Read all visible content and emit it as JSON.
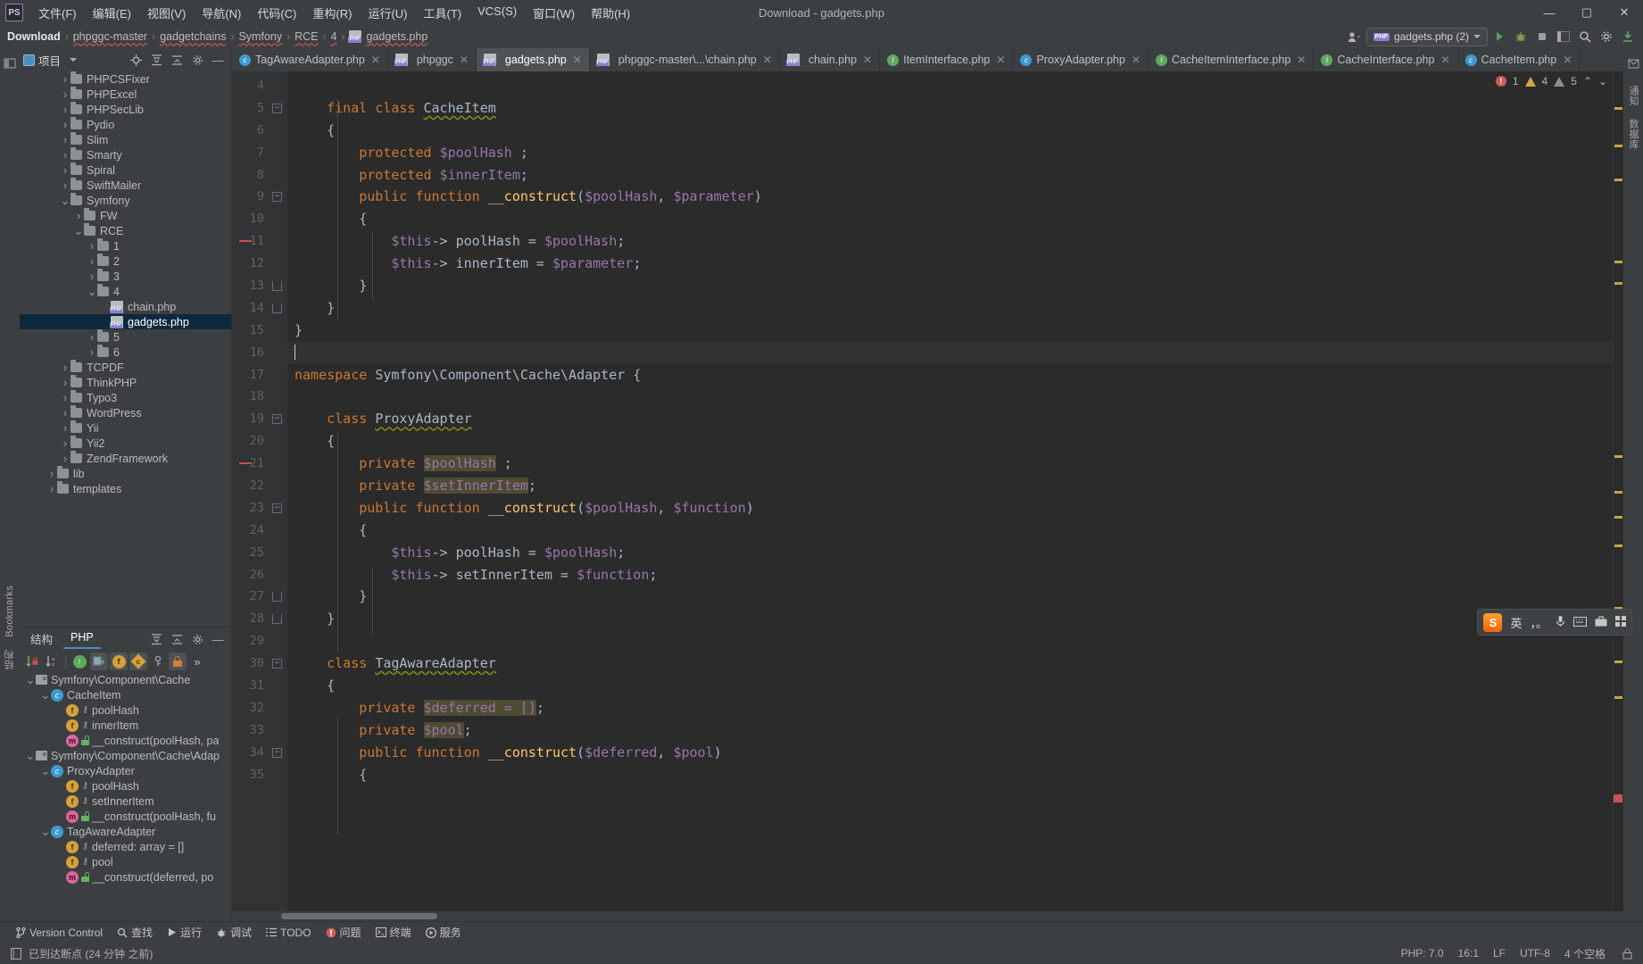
{
  "window": {
    "title": "Download - gadgets.php",
    "app_logo": "PS",
    "minimize": "—",
    "maximize": "▢",
    "close": "✕"
  },
  "menu": [
    {
      "label": "文件(F)",
      "name": "menu-file"
    },
    {
      "label": "编辑(E)",
      "name": "menu-edit"
    },
    {
      "label": "视图(V)",
      "name": "menu-view"
    },
    {
      "label": "导航(N)",
      "name": "menu-navigate"
    },
    {
      "label": "代码(C)",
      "name": "menu-code"
    },
    {
      "label": "重构(R)",
      "name": "menu-refactor"
    },
    {
      "label": "运行(U)",
      "name": "menu-run"
    },
    {
      "label": "工具(T)",
      "name": "menu-tools"
    },
    {
      "label": "VCS(S)",
      "name": "menu-vcs"
    },
    {
      "label": "窗口(W)",
      "name": "menu-window"
    },
    {
      "label": "帮助(H)",
      "name": "menu-help"
    }
  ],
  "breadcrumbs": [
    {
      "label": "Download",
      "icon": ""
    },
    {
      "label": "phpggc-master",
      "icon": ""
    },
    {
      "label": "gadgetchains",
      "icon": ""
    },
    {
      "label": "Symfony",
      "icon": ""
    },
    {
      "label": "RCE",
      "icon": ""
    },
    {
      "label": "4",
      "icon": ""
    },
    {
      "label": "gadgets.php",
      "icon": "php-file-icon"
    }
  ],
  "navbar_right": {
    "run_config": "gadgets.php (2)",
    "user_icon": "user-icon",
    "run": "run-icon",
    "debug": "debug-icon",
    "stop": "stop-icon",
    "layout": "layout-icon",
    "search_everywhere": "magnifier-icon",
    "settings": "gear-icon",
    "updates": "update-icon"
  },
  "project_panel": {
    "title": "项目",
    "tools": [
      "locate-icon",
      "expand-all-icon",
      "collapse-all-icon",
      "gear-icon",
      "hide-icon"
    ],
    "items": [
      {
        "label": "PHPCSFixer",
        "type": "folder",
        "depth": 3,
        "expanded": false
      },
      {
        "label": "PHPExcel",
        "type": "folder",
        "depth": 3,
        "expanded": false
      },
      {
        "label": "PHPSecLib",
        "type": "folder",
        "depth": 3,
        "expanded": false
      },
      {
        "label": "Pydio",
        "type": "folder",
        "depth": 3,
        "expanded": false
      },
      {
        "label": "Slim",
        "type": "folder",
        "depth": 3,
        "expanded": false
      },
      {
        "label": "Smarty",
        "type": "folder",
        "depth": 3,
        "expanded": false
      },
      {
        "label": "Spiral",
        "type": "folder",
        "depth": 3,
        "expanded": false
      },
      {
        "label": "SwiftMailer",
        "type": "folder",
        "depth": 3,
        "expanded": false
      },
      {
        "label": "Symfony",
        "type": "folder",
        "depth": 3,
        "expanded": true,
        "wavy": true
      },
      {
        "label": "FW",
        "type": "folder",
        "depth": 4,
        "expanded": false
      },
      {
        "label": "RCE",
        "type": "folder",
        "depth": 4,
        "expanded": true,
        "wavy": true
      },
      {
        "label": "1",
        "type": "folder",
        "depth": 5,
        "expanded": false
      },
      {
        "label": "2",
        "type": "folder",
        "depth": 5,
        "expanded": false
      },
      {
        "label": "3",
        "type": "folder",
        "depth": 5,
        "expanded": false
      },
      {
        "label": "4",
        "type": "folder",
        "depth": 5,
        "expanded": true,
        "wavy": true
      },
      {
        "label": "chain.php",
        "type": "php",
        "depth": 6,
        "expanded": null
      },
      {
        "label": "gadgets.php",
        "type": "php",
        "depth": 6,
        "expanded": null,
        "selected": true,
        "wavy": true
      },
      {
        "label": "5",
        "type": "folder",
        "depth": 5,
        "expanded": false
      },
      {
        "label": "6",
        "type": "folder",
        "depth": 5,
        "expanded": false
      },
      {
        "label": "TCPDF",
        "type": "folder",
        "depth": 3,
        "expanded": false
      },
      {
        "label": "ThinkPHP",
        "type": "folder",
        "depth": 3,
        "expanded": false
      },
      {
        "label": "Typo3",
        "type": "folder",
        "depth": 3,
        "expanded": false
      },
      {
        "label": "WordPress",
        "type": "folder",
        "depth": 3,
        "expanded": false
      },
      {
        "label": "Yii",
        "type": "folder",
        "depth": 3,
        "expanded": false
      },
      {
        "label": "Yii2",
        "type": "folder",
        "depth": 3,
        "expanded": false
      },
      {
        "label": "ZendFramework",
        "type": "folder",
        "depth": 3,
        "expanded": false
      },
      {
        "label": "lib",
        "type": "folder",
        "depth": 2,
        "expanded": false
      },
      {
        "label": "templates",
        "type": "folder",
        "depth": 2,
        "expanded": false
      }
    ]
  },
  "structure_panel": {
    "tab_structure": "结构",
    "tab_php": "PHP",
    "items": [
      {
        "label": "Symfony\\Component\\Cache",
        "kind": "package",
        "depth": 0,
        "expanded": true
      },
      {
        "label": "CacheItem",
        "kind": "class",
        "depth": 1,
        "expanded": true
      },
      {
        "label": "poolHash",
        "kind": "field",
        "depth": 2,
        "visibility": "protected"
      },
      {
        "label": "innerItem",
        "kind": "field",
        "depth": 2,
        "visibility": "protected"
      },
      {
        "label": "__construct(poolHash, pa",
        "kind": "method",
        "depth": 2,
        "visibility": "public"
      },
      {
        "label": "Symfony\\Component\\Cache\\Adap",
        "kind": "package",
        "depth": 0,
        "expanded": true
      },
      {
        "label": "ProxyAdapter",
        "kind": "class",
        "depth": 1,
        "expanded": true
      },
      {
        "label": "poolHash",
        "kind": "field",
        "depth": 2,
        "visibility": "private"
      },
      {
        "label": "setInnerItem",
        "kind": "field",
        "depth": 2,
        "visibility": "private"
      },
      {
        "label": "__construct(poolHash, fu",
        "kind": "method",
        "depth": 2,
        "visibility": "public"
      },
      {
        "label": "TagAwareAdapter",
        "kind": "class",
        "depth": 1,
        "expanded": true
      },
      {
        "label": "deferred: array = []",
        "kind": "field",
        "depth": 2,
        "visibility": "private"
      },
      {
        "label": "pool",
        "kind": "field",
        "depth": 2,
        "visibility": "private"
      },
      {
        "label": "__construct(deferred, po",
        "kind": "method",
        "depth": 2,
        "visibility": "public"
      }
    ]
  },
  "editor_tabs": [
    {
      "label": "TagAwareAdapter.php",
      "icon": "class-icon",
      "active": false
    },
    {
      "label": "phpggc",
      "icon": "php-file-icon",
      "active": false
    },
    {
      "label": "gadgets.php",
      "icon": "php-file-icon",
      "active": true
    },
    {
      "label": "phpggc-master\\...\\chain.php",
      "icon": "php-file-icon",
      "active": false
    },
    {
      "label": "chain.php",
      "icon": "php-file-icon",
      "active": false
    },
    {
      "label": "ItemInterface.php",
      "icon": "interface-icon",
      "active": false
    },
    {
      "label": "ProxyAdapter.php",
      "icon": "class-icon",
      "active": false
    },
    {
      "label": "CacheItemInterface.php",
      "icon": "interface-icon",
      "active": false
    },
    {
      "label": "CacheInterface.php",
      "icon": "interface-icon",
      "active": false
    },
    {
      "label": "CacheItem.php",
      "icon": "class-icon",
      "active": false
    }
  ],
  "inspections": {
    "errors": "1",
    "warnings": "4",
    "weak_warnings": "5",
    "up": "⌃",
    "down": "⌄"
  },
  "code": {
    "first_line": 4,
    "current_line": 16,
    "lines": [
      {
        "n": 4,
        "tokens": [],
        "fold": null
      },
      {
        "n": 5,
        "tokens": [
          {
            "t": "    ",
            "c": "p"
          },
          {
            "t": "final class ",
            "c": "k"
          },
          {
            "t": "CacheItem",
            "c": "cl"
          }
        ],
        "fold": "start"
      },
      {
        "n": 6,
        "tokens": [
          {
            "t": "    {",
            "c": "p"
          }
        ],
        "fold": null
      },
      {
        "n": 7,
        "tokens": [
          {
            "t": "        ",
            "c": "p"
          },
          {
            "t": "protected ",
            "c": "k"
          },
          {
            "t": "$poolHash",
            "c": "v"
          },
          {
            "t": " ;",
            "c": "p"
          }
        ],
        "fold": null
      },
      {
        "n": 8,
        "tokens": [
          {
            "t": "        ",
            "c": "p"
          },
          {
            "t": "protected ",
            "c": "k"
          },
          {
            "t": "$innerItem",
            "c": "v"
          },
          {
            "t": ";",
            "c": "p"
          }
        ],
        "fold": null
      },
      {
        "n": 9,
        "tokens": [
          {
            "t": "        ",
            "c": "p"
          },
          {
            "t": "public function ",
            "c": "k"
          },
          {
            "t": "__construct",
            "c": "fn"
          },
          {
            "t": "(",
            "c": "p"
          },
          {
            "t": "$poolHash",
            "c": "v"
          },
          {
            "t": ", ",
            "c": "p"
          },
          {
            "t": "$parameter",
            "c": "v"
          },
          {
            "t": ")",
            "c": "p"
          }
        ],
        "fold": "start"
      },
      {
        "n": 10,
        "tokens": [
          {
            "t": "        {",
            "c": "p"
          }
        ],
        "fold": null
      },
      {
        "n": 11,
        "tokens": [
          {
            "t": "            ",
            "c": "p"
          },
          {
            "t": "$this",
            "c": "v"
          },
          {
            "t": "-> poolHash = ",
            "c": "p"
          },
          {
            "t": "$poolHash",
            "c": "v"
          },
          {
            "t": ";",
            "c": "p"
          }
        ],
        "fold": null,
        "breakpoint": true
      },
      {
        "n": 12,
        "tokens": [
          {
            "t": "            ",
            "c": "p"
          },
          {
            "t": "$this",
            "c": "v"
          },
          {
            "t": "-> innerItem = ",
            "c": "p"
          },
          {
            "t": "$parameter",
            "c": "v"
          },
          {
            "t": ";",
            "c": "p"
          }
        ],
        "fold": null
      },
      {
        "n": 13,
        "tokens": [
          {
            "t": "        }",
            "c": "p"
          }
        ],
        "fold": "end"
      },
      {
        "n": 14,
        "tokens": [
          {
            "t": "    }",
            "c": "p"
          }
        ],
        "fold": "end"
      },
      {
        "n": 15,
        "tokens": [
          {
            "t": "}",
            "c": "p"
          }
        ],
        "fold": null
      },
      {
        "n": 16,
        "tokens": [],
        "fold": null,
        "current": true
      },
      {
        "n": 17,
        "tokens": [
          {
            "t": "namespace ",
            "c": "k"
          },
          {
            "t": "Symfony\\Component\\Cache\\Adapter",
            "c": "p"
          },
          {
            "t": " {",
            "c": "p"
          }
        ],
        "fold": null
      },
      {
        "n": 18,
        "tokens": [],
        "fold": null
      },
      {
        "n": 19,
        "tokens": [
          {
            "t": "    ",
            "c": "p"
          },
          {
            "t": "class ",
            "c": "k"
          },
          {
            "t": "ProxyAdapter",
            "c": "cl"
          }
        ],
        "fold": "start"
      },
      {
        "n": 20,
        "tokens": [
          {
            "t": "    {",
            "c": "p"
          }
        ],
        "fold": null
      },
      {
        "n": 21,
        "tokens": [
          {
            "t": "        ",
            "c": "p"
          },
          {
            "t": "private ",
            "c": "k"
          },
          {
            "t": "$poolHash",
            "c": "v",
            "hl": true
          },
          {
            "t": " ;",
            "c": "p"
          }
        ],
        "fold": null,
        "breakpoint": true
      },
      {
        "n": 22,
        "tokens": [
          {
            "t": "        ",
            "c": "p"
          },
          {
            "t": "private ",
            "c": "k"
          },
          {
            "t": "$setInnerItem",
            "c": "v",
            "hl": true
          },
          {
            "t": ";",
            "c": "p"
          }
        ],
        "fold": null
      },
      {
        "n": 23,
        "tokens": [
          {
            "t": "        ",
            "c": "p"
          },
          {
            "t": "public function ",
            "c": "k"
          },
          {
            "t": "__construct",
            "c": "fn"
          },
          {
            "t": "(",
            "c": "p"
          },
          {
            "t": "$poolHash",
            "c": "v"
          },
          {
            "t": ", ",
            "c": "p"
          },
          {
            "t": "$function",
            "c": "v"
          },
          {
            "t": ")",
            "c": "p"
          }
        ],
        "fold": "start"
      },
      {
        "n": 24,
        "tokens": [
          {
            "t": "        {",
            "c": "p"
          }
        ],
        "fold": null
      },
      {
        "n": 25,
        "tokens": [
          {
            "t": "            ",
            "c": "p"
          },
          {
            "t": "$this",
            "c": "v"
          },
          {
            "t": "-> poolHash = ",
            "c": "p"
          },
          {
            "t": "$poolHash",
            "c": "v"
          },
          {
            "t": ";",
            "c": "p"
          }
        ],
        "fold": null
      },
      {
        "n": 26,
        "tokens": [
          {
            "t": "            ",
            "c": "p"
          },
          {
            "t": "$this",
            "c": "v"
          },
          {
            "t": "-> setInnerItem = ",
            "c": "p"
          },
          {
            "t": "$function",
            "c": "v"
          },
          {
            "t": ";",
            "c": "p"
          }
        ],
        "fold": null
      },
      {
        "n": 27,
        "tokens": [
          {
            "t": "        }",
            "c": "p"
          }
        ],
        "fold": "end"
      },
      {
        "n": 28,
        "tokens": [
          {
            "t": "    }",
            "c": "p"
          }
        ],
        "fold": "end"
      },
      {
        "n": 29,
        "tokens": [],
        "fold": null
      },
      {
        "n": 30,
        "tokens": [
          {
            "t": "    ",
            "c": "p"
          },
          {
            "t": "class ",
            "c": "k"
          },
          {
            "t": "TagAwareAdapter",
            "c": "cl"
          }
        ],
        "fold": "start"
      },
      {
        "n": 31,
        "tokens": [
          {
            "t": "    {",
            "c": "p"
          }
        ],
        "fold": null
      },
      {
        "n": 32,
        "tokens": [
          {
            "t": "        ",
            "c": "p"
          },
          {
            "t": "private ",
            "c": "k"
          },
          {
            "t": "$deferred = []",
            "c": "v",
            "hl": true
          },
          {
            "t": ";",
            "c": "p"
          }
        ],
        "fold": null
      },
      {
        "n": 33,
        "tokens": [
          {
            "t": "        ",
            "c": "p"
          },
          {
            "t": "private ",
            "c": "k"
          },
          {
            "t": "$pool",
            "c": "v",
            "hl": true
          },
          {
            "t": ";",
            "c": "p"
          }
        ],
        "fold": null
      },
      {
        "n": 34,
        "tokens": [
          {
            "t": "        ",
            "c": "p"
          },
          {
            "t": "public function ",
            "c": "k"
          },
          {
            "t": "__construct",
            "c": "fn"
          },
          {
            "t": "(",
            "c": "p"
          },
          {
            "t": "$deferred",
            "c": "v"
          },
          {
            "t": ", ",
            "c": "p"
          },
          {
            "t": "$pool",
            "c": "v"
          },
          {
            "t": ")",
            "c": "p"
          }
        ],
        "fold": "start"
      },
      {
        "n": 35,
        "tokens": [
          {
            "t": "        {",
            "c": "p"
          }
        ],
        "fold": null
      }
    ]
  },
  "ime": {
    "logo": "S",
    "mode": "英",
    "comma_dot": "，。",
    "mic": "mic-icon",
    "keyboard": "keyboard-icon",
    "toolbox": "toolbox-icon",
    "grid": "grid-icon"
  },
  "tool_windows": [
    {
      "label": "Version Control",
      "icon": "branch-icon"
    },
    {
      "label": "查找",
      "icon": "magnifier-icon"
    },
    {
      "label": "运行",
      "icon": "play-icon"
    },
    {
      "label": "调试",
      "icon": "bug-icon"
    },
    {
      "label": "TODO",
      "icon": "list-icon"
    },
    {
      "label": "问题",
      "icon": "error-icon"
    },
    {
      "label": "终端",
      "icon": "terminal-icon"
    },
    {
      "label": "服务",
      "icon": "services-icon"
    }
  ],
  "statusbar": {
    "message": "已到达断点 (24 分钟 之前)",
    "php_version": "PHP: 7.0",
    "caret": "16:1",
    "line_sep": "LF",
    "encoding": "UTF-8",
    "indent": "4 个空格"
  },
  "left_strip": {
    "bookmarks": "Bookmarks",
    "structure": "结构"
  },
  "right_strip": {
    "notifications": "通知",
    "database": "数据库"
  }
}
